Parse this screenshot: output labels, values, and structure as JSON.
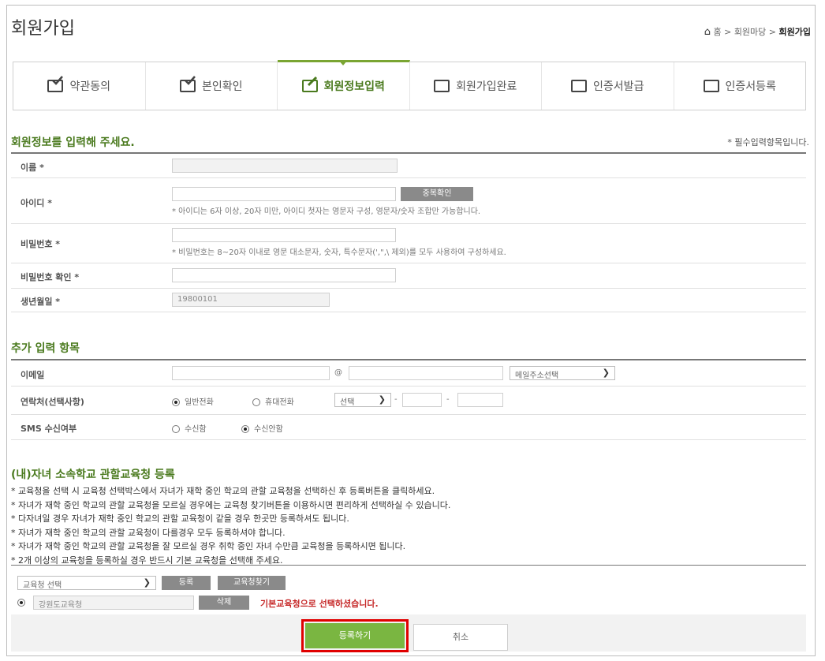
{
  "header": {
    "title": "회원가입",
    "breadcrumb": {
      "home": "홈",
      "sep1": ">",
      "parent": "회원마당",
      "sep2": ">",
      "current": "회원가입"
    }
  },
  "tabs": [
    {
      "label": "약관동의",
      "icon": "check-doc-icon",
      "active": false
    },
    {
      "label": "본인확인",
      "icon": "check-doc-icon",
      "active": false
    },
    {
      "label": "회원정보입력",
      "icon": "edit-doc-icon",
      "active": true
    },
    {
      "label": "회원가입완료",
      "icon": "monitor-user-icon",
      "active": false
    },
    {
      "label": "인증서발급",
      "icon": "certificate-icon",
      "active": false
    },
    {
      "label": "인증서등록",
      "icon": "register-icon",
      "active": false
    }
  ],
  "member_info": {
    "title": "회원정보를 입력해 주세요.",
    "required_note": "* 필수입력항목입니다.",
    "name_label": "이름 *",
    "id_label": "아이디 *",
    "id_check_button": "중복확인",
    "id_help": "* 아이디는 6자 이상, 20자 미만, 아이디 첫자는 영문자 구성, 영문자/숫자 조합만 가능합니다.",
    "pw_label": "비밀번호 *",
    "pw_help": "* 비밀번호는 8~20자 이내로 영문 대소문자, 숫자, 특수문자(',\",\\ 제외)를 모두 사용하여 구성하세요.",
    "pw_confirm_label": "비밀번호 확인 *",
    "birth_label": "생년월일 *",
    "birth_value": "19800101"
  },
  "extra": {
    "title": "추가 입력 항목",
    "email_label": "이메일",
    "email_at": "@",
    "email_select": "메일주소선택",
    "phone_label": "연락처(선택사항)",
    "phone_opt1": "일반전화",
    "phone_opt2": "휴대전화",
    "phone_select": "선택",
    "dash": "-",
    "sms_label": "SMS 수신여부",
    "sms_opt1": "수신함",
    "sms_opt2": "수신안함"
  },
  "school": {
    "title": "(내)자녀 소속학교 관할교육청 등록",
    "notes": [
      "* 교육청을 선택 시 교육청 선택박스에서 자녀가 재학 중인 학교의 관할 교육청을 선택하신 후 등록버튼을 클릭하세요.",
      "* 자녀가 재학 중인 학교의 관할 교육청을 모르실 경우에는 교육청 찾기버튼을 이용하시면 편리하게 선택하실 수 있습니다.",
      "* 다자녀일 경우 자녀가 재학 중인 학교의 관할 교육청이 같을 경우 한곳만 등록하셔도 됩니다.",
      "* 자녀가 재학 중인 학교의 관할 교육청이 다를경우 모두 등록하셔야 합니다.",
      "* 자녀가 재학 중인 학교의 관할 교육청을 잘 모르실 경우 취학 중인 자녀 수만큼 교육청을 등록하시면 됩니다.",
      "* 2개 이상의 교육청을 등록하실 경우 반드시 기본 교육청을 선택해 주세요."
    ],
    "select_placeholder": "교육청 선택",
    "register_button": "등록",
    "find_button": "교육청찾기",
    "office_value": "강원도교육청",
    "delete_button": "삭제",
    "default_note": "기본교육청으로 선택하셨습니다."
  },
  "footer": {
    "submit": "등록하기",
    "cancel": "취소"
  },
  "colors": {
    "accent_green": "#4a7a1e",
    "submit_green": "#7ab641",
    "highlight_red": "#e00000"
  }
}
